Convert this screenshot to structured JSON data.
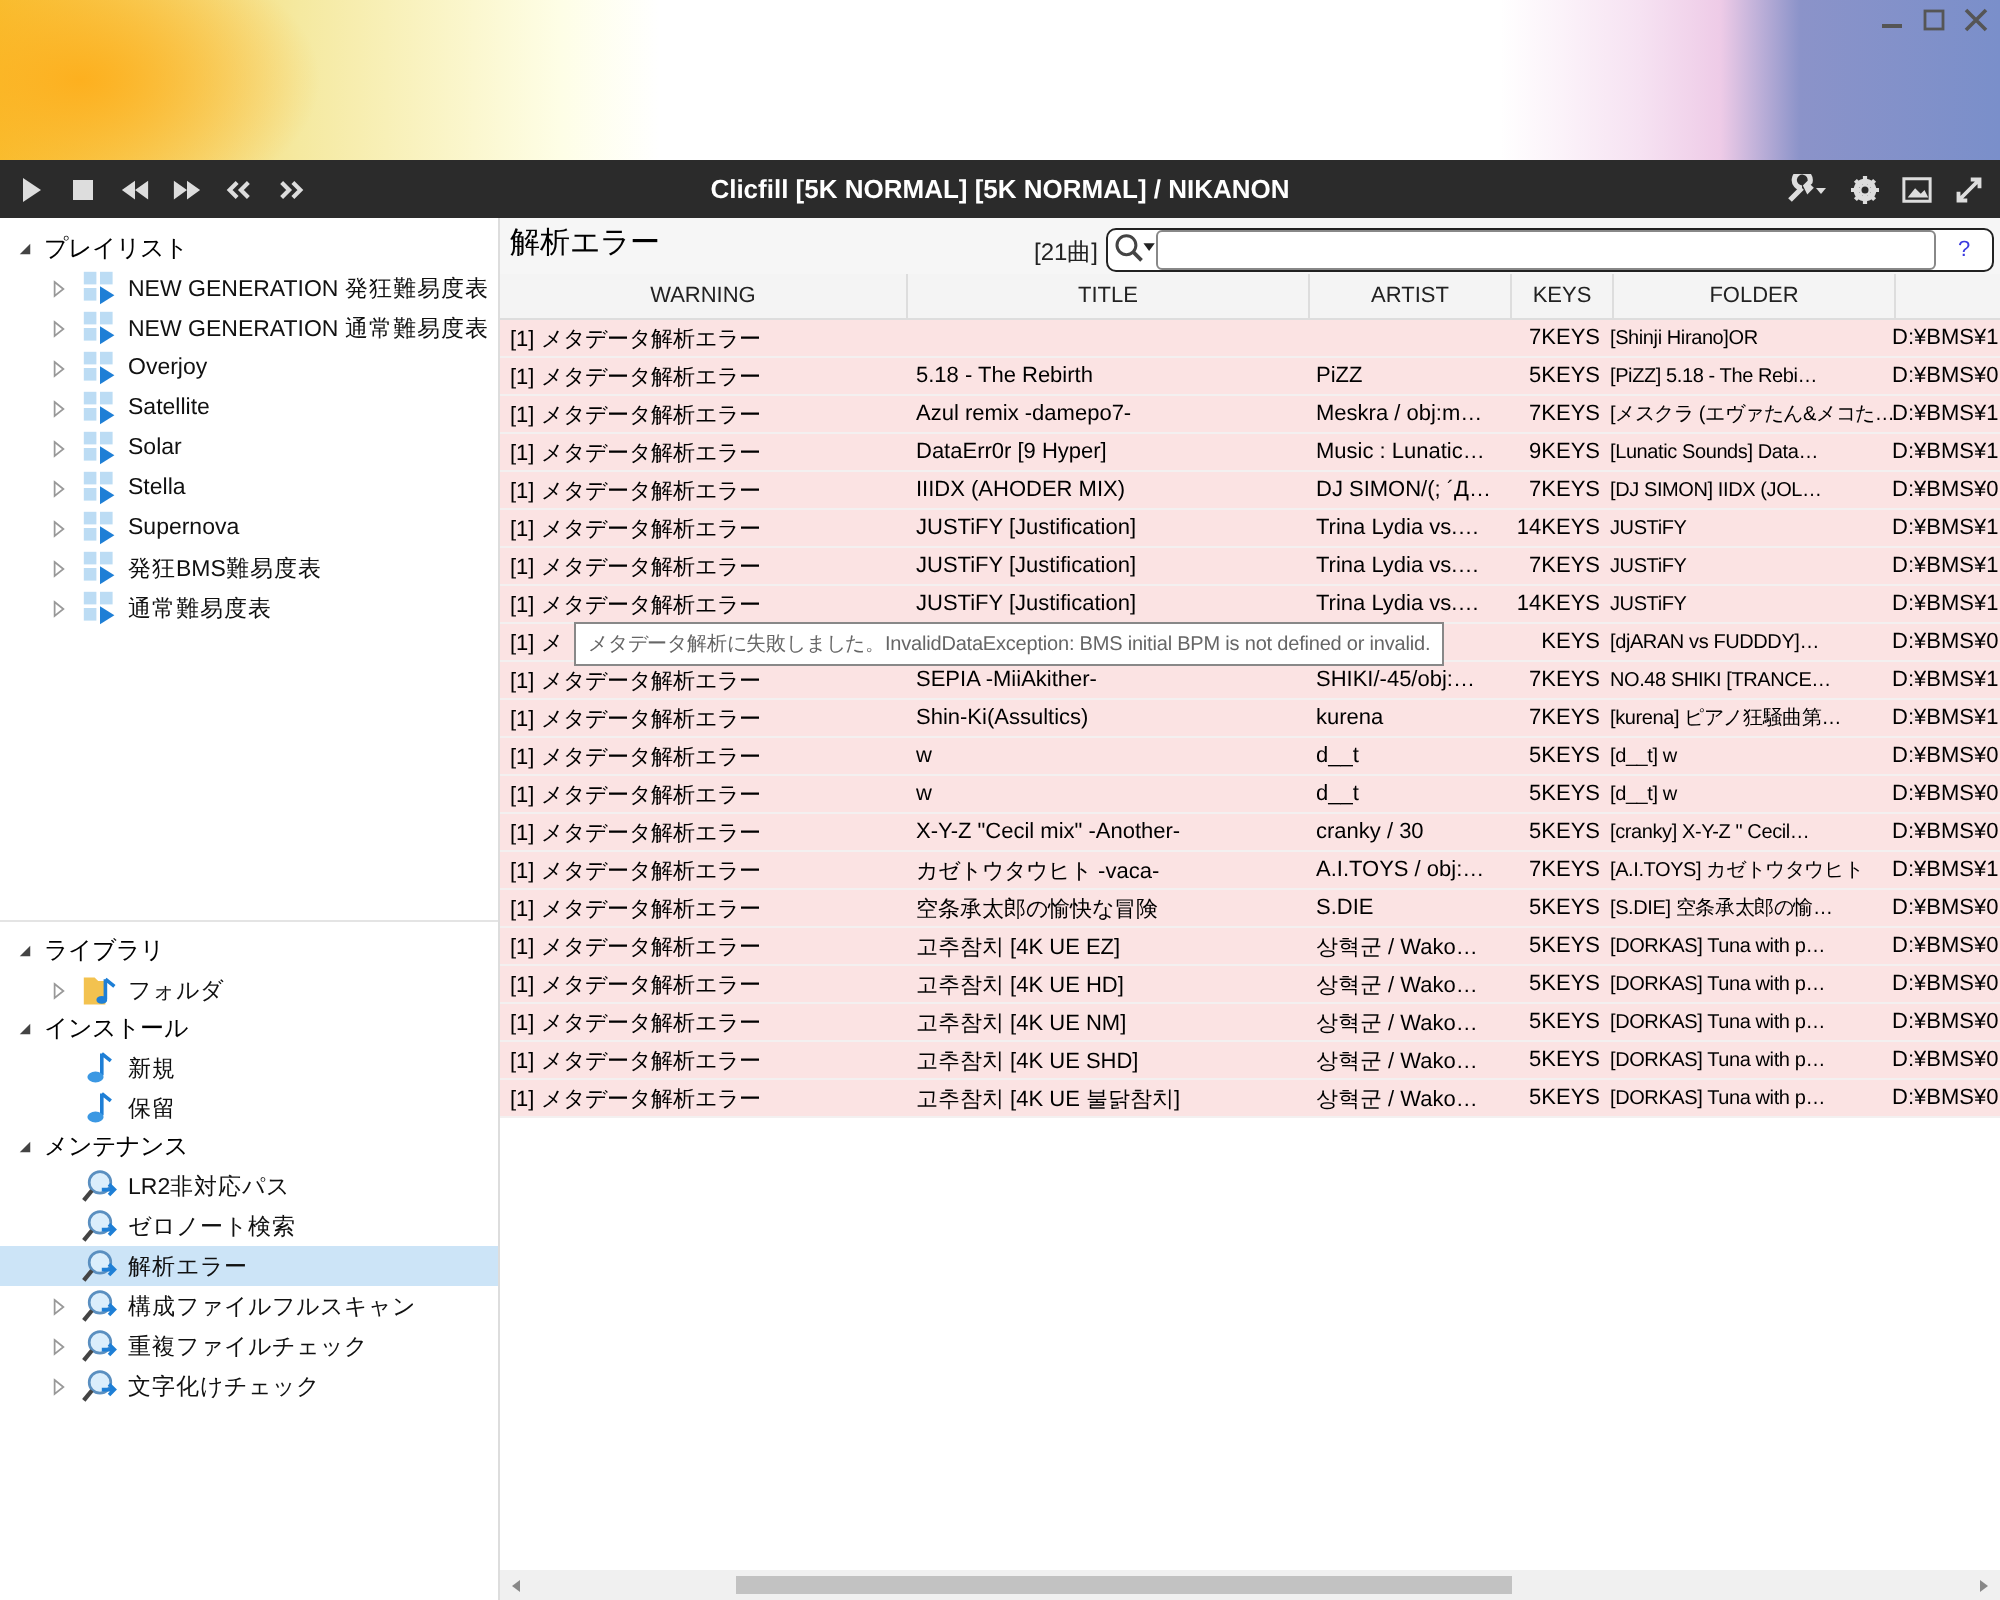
{
  "toolbar": {
    "title": "Clicfill [5K NORMAL] [5K NORMAL] / NIKANON"
  },
  "sidebar": {
    "panes": [
      {
        "sections": [
          {
            "label": "プレイリスト",
            "expanded": true,
            "children": [
              {
                "label": "NEW GENERATION 発狂難易度表",
                "kind": "playlist",
                "has_children": true,
                "selected": false
              },
              {
                "label": "NEW GENERATION 通常難易度表",
                "kind": "playlist",
                "has_children": true,
                "selected": false
              },
              {
                "label": "Overjoy",
                "kind": "playlist",
                "has_children": true,
                "selected": false
              },
              {
                "label": "Satellite",
                "kind": "playlist",
                "has_children": true,
                "selected": false
              },
              {
                "label": "Solar",
                "kind": "playlist",
                "has_children": true,
                "selected": false
              },
              {
                "label": "Stella",
                "kind": "playlist",
                "has_children": true,
                "selected": false
              },
              {
                "label": "Supernova",
                "kind": "playlist",
                "has_children": true,
                "selected": false
              },
              {
                "label": "発狂BMS難易度表",
                "kind": "playlist",
                "has_children": true,
                "selected": false
              },
              {
                "label": "通常難易度表",
                "kind": "playlist",
                "has_children": true,
                "selected": false
              }
            ]
          }
        ]
      },
      {
        "sections": [
          {
            "label": "ライブラリ",
            "expanded": true,
            "children": [
              {
                "label": "フォルダ",
                "kind": "folder",
                "has_children": true,
                "selected": false
              }
            ]
          },
          {
            "label": "インストール",
            "expanded": true,
            "children": [
              {
                "label": "新規",
                "kind": "note",
                "has_children": false,
                "selected": false
              },
              {
                "label": "保留",
                "kind": "note",
                "has_children": false,
                "selected": false
              }
            ]
          },
          {
            "label": "メンテナンス",
            "expanded": true,
            "children": [
              {
                "label": "LR2非対応パス",
                "kind": "search",
                "has_children": false,
                "selected": false
              },
              {
                "label": "ゼロノート検索",
                "kind": "search",
                "has_children": false,
                "selected": false
              },
              {
                "label": "解析エラー",
                "kind": "search",
                "has_children": false,
                "selected": true
              },
              {
                "label": "構成ファイルフルスキャン",
                "kind": "search",
                "has_children": true,
                "selected": false
              },
              {
                "label": "重複ファイルチェック",
                "kind": "search",
                "has_children": true,
                "selected": false
              },
              {
                "label": "文字化けチェック",
                "kind": "search",
                "has_children": true,
                "selected": false
              }
            ]
          }
        ]
      }
    ]
  },
  "main": {
    "title": "解析エラー",
    "count": "[21曲]",
    "help": "?",
    "table": {
      "columns": [
        "WARNING",
        "TITLE",
        "ARTIST",
        "KEYS",
        "FOLDER"
      ],
      "rows": [
        [
          "[1] メタデータ解析エラー",
          "",
          "",
          "7KEYS",
          "[Shinji Hirano]OR",
          "D:¥BMS¥1"
        ],
        [
          "[1] メタデータ解析エラー",
          "5.18 - The Rebirth",
          "PiZZ",
          "5KEYS",
          "[PiZZ] 5.18 - The Rebi…",
          "D:¥BMS¥0"
        ],
        [
          "[1] メタデータ解析エラー",
          "Azul remix -damepo7-",
          "Meskra / obj:m…",
          "7KEYS",
          "[メスクラ (エヴァたん&メコた…",
          "D:¥BMS¥1"
        ],
        [
          "[1] メタデータ解析エラー",
          "DataErr0r [9 Hyper]",
          "Music : Lunatic…",
          "9KEYS",
          "[Lunatic Sounds] Data…",
          "D:¥BMS¥1"
        ],
        [
          "[1] メタデータ解析エラー",
          "IIIDX (AHODER MIX)",
          "DJ SIMON/(; ´Д…",
          "7KEYS",
          "[DJ SIMON] IIDX (JOL…",
          "D:¥BMS¥0"
        ],
        [
          "[1] メタデータ解析エラー",
          "JUSTiFY [Justification]",
          "Trina Lydia vs.…",
          "14KEYS",
          "JUSTiFY",
          "D:¥BMS¥1"
        ],
        [
          "[1] メタデータ解析エラー",
          "JUSTiFY [Justification]",
          "Trina Lydia vs.…",
          "7KEYS",
          "JUSTiFY",
          "D:¥BMS¥1"
        ],
        [
          "[1] メタデータ解析エラー",
          "JUSTiFY [Justification]",
          "Trina Lydia vs.…",
          "14KEYS",
          "JUSTiFY",
          "D:¥BMS¥1"
        ],
        [
          "[1] メ",
          "",
          "",
          "KEYS",
          "[djARAN vs FUDDDY]…",
          "D:¥BMS¥0"
        ],
        [
          "[1] メタデータ解析エラー",
          "SEPIA -MiiAkither-",
          "SHIKI/-45/obj:…",
          "7KEYS",
          "NO.48 SHIKI [TRANCE…",
          "D:¥BMS¥1"
        ],
        [
          "[1] メタデータ解析エラー",
          "Shin-Ki(Assultics)",
          "kurena",
          "7KEYS",
          "[kurena] ピアノ狂騒曲第…",
          "D:¥BMS¥1"
        ],
        [
          "[1] メタデータ解析エラー",
          "w",
          "d__t",
          "5KEYS",
          "[d__t] w",
          "D:¥BMS¥0"
        ],
        [
          "[1] メタデータ解析エラー",
          "w",
          "d__t",
          "5KEYS",
          "[d__t] w",
          "D:¥BMS¥0"
        ],
        [
          "[1] メタデータ解析エラー",
          "X-Y-Z \"Cecil mix\" -Another-",
          "cranky / 30",
          "5KEYS",
          "[cranky] X-Y-Z \" Cecil…",
          "D:¥BMS¥0"
        ],
        [
          "[1] メタデータ解析エラー",
          "カゼトウタウヒト -vaca-",
          "A.I.TOYS / obj:…",
          "7KEYS",
          "[A.I.TOYS] カゼトウタウヒト",
          "D:¥BMS¥1"
        ],
        [
          "[1] メタデータ解析エラー",
          "空条承太郎の愉快な冒険",
          "S.DIE",
          "5KEYS",
          "[S.DIE] 空条承太郎の愉…",
          "D:¥BMS¥0"
        ],
        [
          "[1] メタデータ解析エラー",
          "고추참치 [4K UE EZ]",
          "상혁군 / Wako…",
          "5KEYS",
          "[DORKAS] Tuna with p…",
          "D:¥BMS¥0"
        ],
        [
          "[1] メタデータ解析エラー",
          "고추참치 [4K UE HD]",
          "상혁군 / Wako…",
          "5KEYS",
          "[DORKAS] Tuna with p…",
          "D:¥BMS¥0"
        ],
        [
          "[1] メタデータ解析エラー",
          "고추참치 [4K UE NM]",
          "상혁군 / Wako…",
          "5KEYS",
          "[DORKAS] Tuna with p…",
          "D:¥BMS¥0"
        ],
        [
          "[1] メタデータ解析エラー",
          "고추참치 [4K UE SHD]",
          "상혁군 / Wako…",
          "5KEYS",
          "[DORKAS] Tuna with p…",
          "D:¥BMS¥0"
        ],
        [
          "[1] メタデータ解析エラー",
          "고추참치 [4K UE 불닭참치]",
          "상혁군 / Wako…",
          "5KEYS",
          "[DORKAS] Tuna with p…",
          "D:¥BMS¥0"
        ]
      ]
    },
    "tooltip": "メタデータ解析に失敗しました。InvalidDataException: BMS initial BPM is not defined or invalid."
  }
}
